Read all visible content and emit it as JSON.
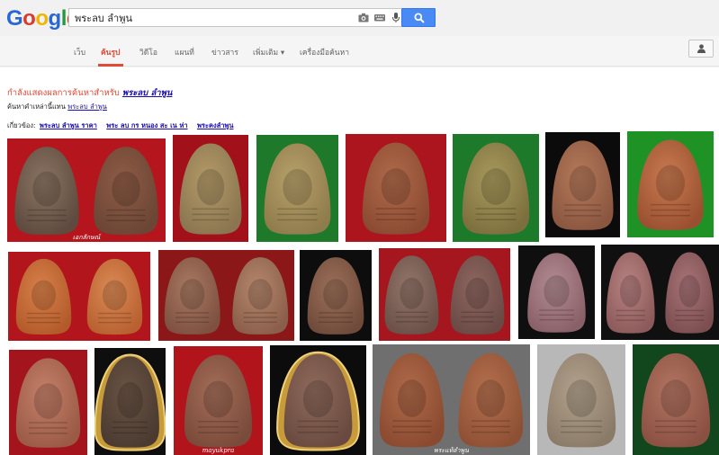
{
  "logo": {
    "text": "Google",
    "colors": [
      "#2a67d6",
      "#d93b2e",
      "#f1b400",
      "#2a67d6",
      "#22993c",
      "#d93b2e"
    ]
  },
  "search": {
    "query": "พระลบ ลำพูน",
    "icons": [
      "camera-icon",
      "keyboard-icon",
      "mic-icon",
      "search-icon"
    ]
  },
  "nav": {
    "items": [
      "เว็บ",
      "ค้นรูป",
      "วิดีโอ",
      "แผนที่",
      "ข่าวสาร",
      "เพิ่มเติม",
      "เครื่องมือค้นหา"
    ],
    "active": "ค้นรูป",
    "more_arrow": "▾"
  },
  "results": {
    "showing_prefix": "กำลังแสดงผลการค้นหาสำหรับ",
    "showing_query": "พระลบ ลำพูน",
    "instead_prefix": "ค้นหาคำเหล่านี้แทน",
    "instead_query": "พระลบ ลำพูน",
    "related_prefix": "เกี่ยวข้อง:",
    "related": [
      "พระลบ ลำพูน ราคา",
      "พระ ลบ กร หนอง สะ เน ห่า",
      "พระคงลำพูน"
    ]
  },
  "accent_color": "#dd4b39",
  "link_color": "#1a0dab",
  "images": [
    {
      "bg": "#b5151d",
      "amulets": [
        [
          "#5e4a3e",
          "#8a7563"
        ],
        [
          "#6b4535",
          "#8e5c45"
        ]
      ],
      "caption": "เอกลักษณ์"
    },
    {
      "bg": "#a2101a",
      "amulets": [
        [
          "#8a7550",
          "#b39a68"
        ]
      ]
    },
    {
      "bg": "#1e7a2a",
      "amulets": [
        [
          "#8f7c4c",
          "#b7a06a"
        ]
      ]
    },
    {
      "bg": "#ad151e",
      "amulets": [
        [
          "#8a4a32",
          "#b06a4a"
        ]
      ]
    },
    {
      "bg": "#1d7a2b",
      "amulets": [
        [
          "#7c6f3e",
          "#a89a5c"
        ]
      ]
    },
    {
      "bg": "#0b0b0b",
      "amulets": [
        [
          "#8a5640",
          "#b57a5a"
        ]
      ]
    },
    {
      "bg": "#1f9226",
      "amulets": [
        [
          "#9a5030",
          "#c87a50"
        ]
      ]
    },
    {
      "bg": "#b3151c",
      "amulets": [
        [
          "#b35a2a",
          "#d8814a"
        ],
        [
          "#b86030",
          "#da8a55"
        ]
      ]
    },
    {
      "bg": "#8b1718",
      "amulets": [
        [
          "#7d5040",
          "#a97a62"
        ],
        [
          "#8a5e4a",
          "#b5876c"
        ]
      ]
    },
    {
      "bg": "#0d0d0d",
      "amulets": [
        [
          "#6f4a3a",
          "#9c7059"
        ]
      ]
    },
    {
      "bg": "#a5161e",
      "amulets": [
        [
          "#6a5048",
          "#94766a"
        ],
        [
          "#6a4a45",
          "#8e6660"
        ]
      ]
    },
    {
      "bg": "#0f0f0f",
      "amulets": [
        [
          "#8a6068",
          "#b28b92"
        ]
      ]
    },
    {
      "bg": "#101010",
      "amulets": [
        [
          "#8c5a5a",
          "#b88282"
        ],
        [
          "#7c4e50",
          "#a87478"
        ]
      ]
    },
    {
      "bg": "#a4141c",
      "amulets": [
        [
          "#9a5a45",
          "#c4806a"
        ]
      ]
    },
    {
      "bg": "#0e0e0e",
      "amulets": [
        [
          "#4a3a30",
          "#6a5444"
        ]
      ],
      "pendant": true
    },
    {
      "bg": "#b2141b",
      "amulets": [
        [
          "#7a4a3a",
          "#a36d58"
        ]
      ],
      "caption": "mayukpra"
    },
    {
      "bg": "#0c0c0c",
      "amulets": [
        [
          "#6a4a40",
          "#8e6a5a"
        ]
      ],
      "pendant": true
    },
    {
      "bg": "#6f6f6f",
      "amulets": [
        [
          "#8a4a30",
          "#b06a4a"
        ],
        [
          "#8e5034",
          "#b4704e"
        ]
      ],
      "caption": "พระแท้ลำพูน"
    },
    {
      "bg": "#b8b8b8",
      "amulets": [
        [
          "#8a7a68",
          "#b3a28c"
        ]
      ]
    },
    {
      "bg": "#12461c",
      "amulets": [
        [
          "#8a5042",
          "#b37562"
        ]
      ]
    }
  ]
}
